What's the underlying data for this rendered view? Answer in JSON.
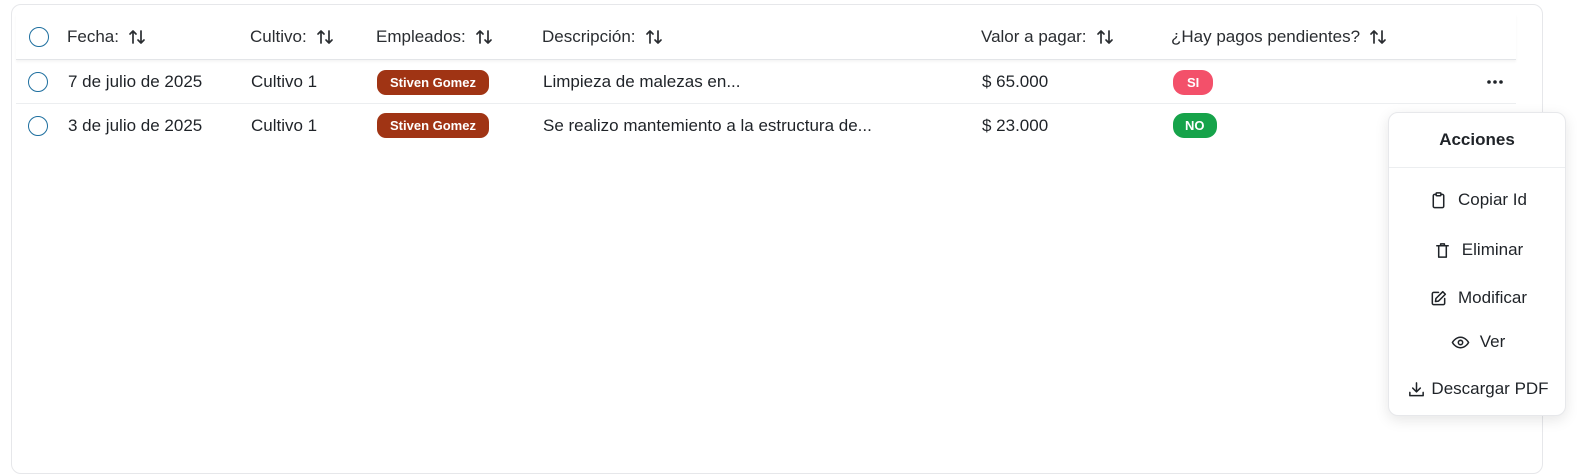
{
  "table": {
    "columns": [
      {
        "label": "Fecha:"
      },
      {
        "label": "Cultivo:"
      },
      {
        "label": "Empleados:"
      },
      {
        "label": "Descripción:"
      },
      {
        "label": "Valor a pagar:"
      },
      {
        "label": "¿Hay pagos pendientes?"
      }
    ],
    "rows": [
      {
        "fecha": "7 de julio de 2025",
        "cultivo": "Cultivo 1",
        "empleado": "Stiven Gomez",
        "descripcion": "Limpieza de malezas en...",
        "valor": "$ 65.000",
        "pendiente": "SI"
      },
      {
        "fecha": "3 de julio de 2025",
        "cultivo": "Cultivo 1",
        "empleado": "Stiven Gomez",
        "descripcion": "Se realizo mantemiento a la estructura de...",
        "valor": "$ 23.000",
        "pendiente": "NO"
      }
    ]
  },
  "menu": {
    "title": "Acciones",
    "items": [
      {
        "label": "Copiar Id",
        "icon": "clipboard-icon"
      },
      {
        "label": "Eliminar",
        "icon": "trash-icon"
      },
      {
        "label": "Modificar",
        "icon": "edit-icon"
      },
      {
        "label": "Ver",
        "icon": "eye-icon"
      },
      {
        "label": "Descargar PDF",
        "icon": "download-icon"
      }
    ]
  },
  "colors": {
    "employee_chip": "#a03414",
    "pending_yes": "#f3506a",
    "pending_no": "#16a34a",
    "checkbox_border": "#1e6f9f"
  }
}
